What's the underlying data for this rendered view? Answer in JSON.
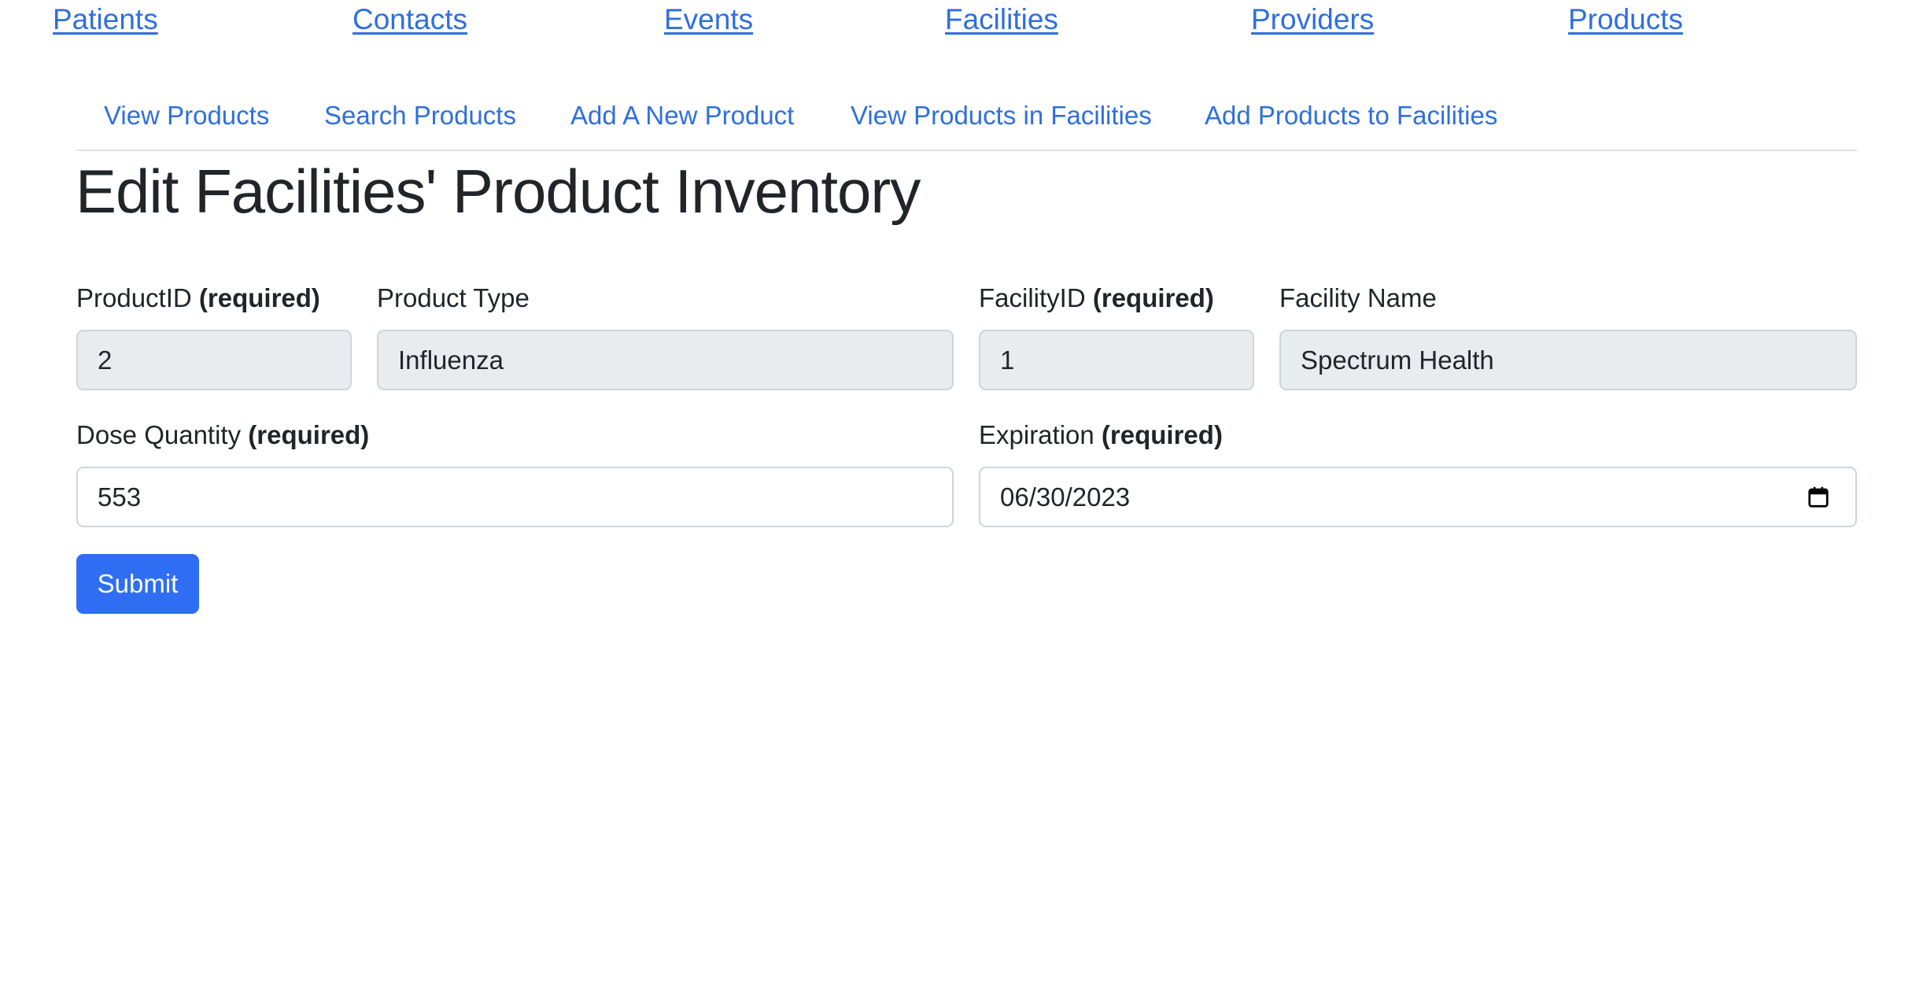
{
  "topnav": {
    "patients": "Patients",
    "contacts": "Contacts",
    "events": "Events",
    "facilities": "Facilities",
    "providers": "Providers",
    "products": "Products"
  },
  "subnav": {
    "view_products": "View Products",
    "search_products": "Search Products",
    "add_product": "Add A New Product",
    "view_products_in_facilities": "View Products in Facilities",
    "add_products_to_facilities": "Add Products to Facilities"
  },
  "page_title": "Edit Facilities' Product Inventory",
  "form": {
    "required_marker": "(required)",
    "product_id": {
      "label": "ProductID",
      "value": "2"
    },
    "product_type": {
      "label": "Product Type",
      "value": "Influenza"
    },
    "facility_id": {
      "label": "FacilityID",
      "value": "1"
    },
    "facility_name": {
      "label": "Facility Name",
      "value": "Spectrum Health"
    },
    "dose_quantity": {
      "label": "Dose Quantity",
      "value": "553"
    },
    "expiration": {
      "label": "Expiration",
      "value": "06/30/2023"
    },
    "submit_label": "Submit"
  },
  "colors": {
    "link": "#2f6fde",
    "primary_button": "#2f6ef3",
    "readonly_bg": "#e9ecef"
  },
  "icons": {
    "expiration_picker": "calendar-icon"
  }
}
